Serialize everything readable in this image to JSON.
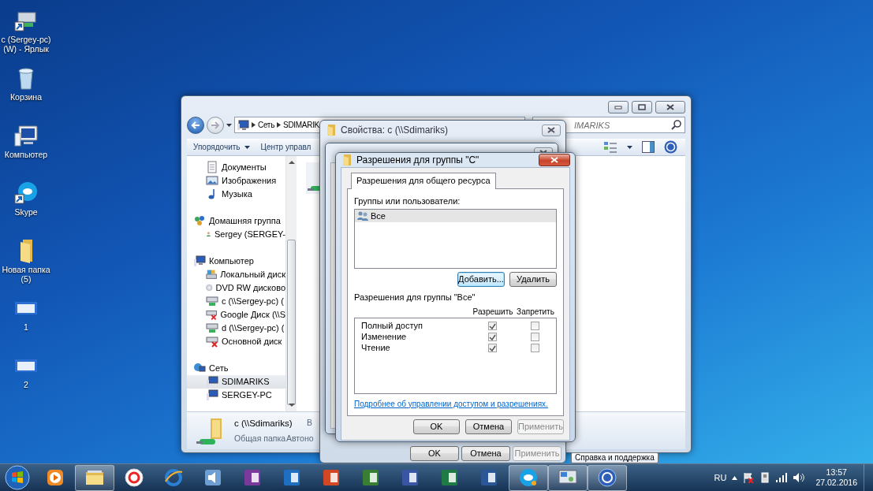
{
  "desktop_icons": [
    {
      "label": "c (Sergey-pc) (W) - Ярлык"
    },
    {
      "label": "Корзина"
    },
    {
      "label": "Компьютер"
    },
    {
      "label": "Skype"
    },
    {
      "label": "Новая папка (5)"
    },
    {
      "label": "1"
    },
    {
      "label": "2"
    }
  ],
  "explorer": {
    "breadcrumb": [
      "Сеть",
      "SDIMARIK"
    ],
    "search_text": "IMARIKS",
    "toolbar": [
      "Упорядочить",
      "Центр управл"
    ],
    "sidebar": {
      "items": [
        {
          "children": [
            {
              "label": "Документы",
              "selected": false
            },
            {
              "label": "Изображения",
              "selected": false
            },
            {
              "label": "Музыка",
              "selected": false
            }
          ]
        },
        {
          "label": "Домашняя группа",
          "selected": false,
          "children": [
            {
              "label": "Sergey (SERGEY-",
              "selected": false
            }
          ]
        },
        {
          "label": "Компьютер",
          "selected": false,
          "children": [
            {
              "label": "Локальный диск",
              "selected": false
            },
            {
              "label": "DVD RW дисково",
              "selected": false
            },
            {
              "label": "c (\\\\Sergey-pc) (",
              "selected": false
            },
            {
              "label": "Google Диск (\\\\S",
              "selected": false
            },
            {
              "label": "d (\\\\Sergey-pc) (",
              "selected": false
            },
            {
              "label": "Основной диск",
              "selected": false
            }
          ]
        },
        {
          "label": "Сеть",
          "selected": false,
          "children": [
            {
              "label": "SDIMARIKS",
              "selected": true
            },
            {
              "label": "SERGEY-PC",
              "selected": false
            }
          ]
        }
      ]
    },
    "details": {
      "name": "c (\\\\Sdimariks)",
      "type": "Общая папка",
      "column_3": "В",
      "column_4": "Автоно"
    }
  },
  "properties_dialog": {
    "title": "Свойства: c (\\\\Sdimariks)",
    "buttons": [
      {
        "label": "OK",
        "disabled": false
      },
      {
        "label": "Отмена",
        "disabled": false
      },
      {
        "label": "Применить",
        "disabled": true
      }
    ]
  },
  "permissions_dialog": {
    "title": "Разрешения для группы \"C\"",
    "tabs": [
      {
        "label": "Разрешения для общего ресурса",
        "selected": true
      }
    ],
    "users_label": "Группы или пользователи:",
    "users": [
      {
        "label": "Все",
        "selected": true
      }
    ],
    "list_buttons": [
      {
        "label": "Добавить...",
        "focused": true
      },
      {
        "label": "Удалить",
        "focused": false
      }
    ],
    "permissions_label": "Разрешения для группы \"Все\"",
    "columns": [
      "Разрешить",
      "Запретить"
    ],
    "permissions": [
      {
        "name": "Полный доступ",
        "allow": true,
        "deny": false
      },
      {
        "name": "Изменение",
        "allow": true,
        "deny": false
      },
      {
        "name": "Чтение",
        "allow": true,
        "deny": false
      }
    ],
    "help_link": "Подробнее об управлении доступом и разрешениях.",
    "buttons": [
      {
        "label": "OK",
        "disabled": false
      },
      {
        "label": "Отмена",
        "disabled": false
      },
      {
        "label": "Применить",
        "disabled": true
      }
    ]
  },
  "tooltip": "Справка и поддержка",
  "taskbar": {
    "apps": [
      {
        "selected": false
      },
      {
        "selected": true
      },
      {
        "selected": false
      },
      {
        "selected": false
      },
      {
        "selected": false
      },
      {
        "selected": false
      },
      {
        "selected": false
      },
      {
        "selected": false
      },
      {
        "selected": false
      },
      {
        "selected": false
      },
      {
        "selected": false
      },
      {
        "selected": false
      },
      {
        "selected": true
      },
      {
        "selected": true
      },
      {
        "selected": true
      }
    ],
    "language": "RU",
    "time": "13:57",
    "date": "27.02.2016"
  }
}
